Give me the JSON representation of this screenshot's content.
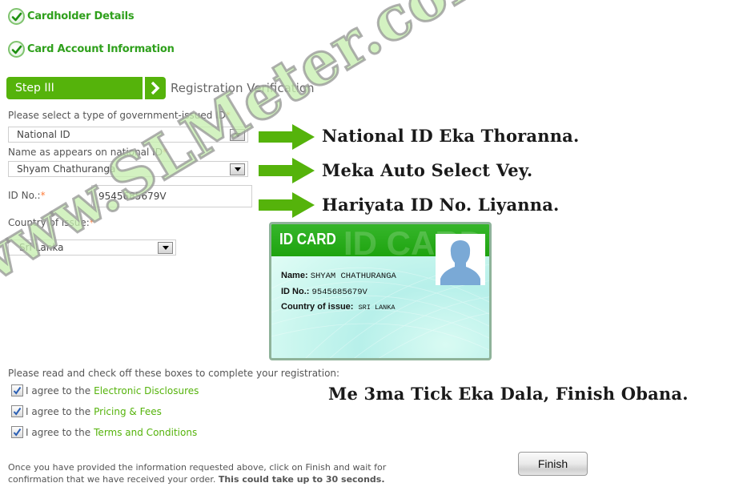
{
  "completed_steps": [
    {
      "label": "Cardholder Details",
      "icon": "check-circle-icon"
    },
    {
      "label": "Card Account Information",
      "icon": "check-circle-icon"
    }
  ],
  "current_step": {
    "step_label": "Step III",
    "title": "Registration Verification",
    "icon": "chevron-right-icon"
  },
  "form": {
    "id_type": {
      "label": "Please select a type of government-issued ID",
      "required_mark": "*",
      "value": "National ID"
    },
    "name": {
      "label": "Name as appears on national ID",
      "required_mark": "*",
      "value": "Shyam Chathuranga"
    },
    "id_no": {
      "label": "ID No.:",
      "required_mark": "*",
      "value": "9545685679V"
    },
    "country": {
      "label": "Country of issue:",
      "required_mark": "*",
      "value": "Sri Lanka"
    }
  },
  "annotations": {
    "note1": "National ID Eka Thoranna.",
    "note2": "Meka Auto Select Vey.",
    "note3": "Hariyata ID No. Liyanna.",
    "note4": "Me 3ma Tick Eka Dala, Finish Obana.",
    "arrow_color": "#55b30b"
  },
  "id_card": {
    "title": "ID CARD",
    "ghost_text": "ID CARD",
    "name_label": "Name:",
    "name_value": "SHYAM CHATHURANGA",
    "id_label": "ID No.:",
    "id_value": "9545685679V",
    "country_label": "Country of issue:",
    "country_value": "SRI LANKA",
    "photo_icon": "person-silhouette-icon"
  },
  "agreements": {
    "title": "Please read and check off these boxes to complete your registration:",
    "items": [
      {
        "prefix": "I agree to the",
        "link": "Electronic Disclosures",
        "checked": true
      },
      {
        "prefix": "I agree to the",
        "link": "Pricing & Fees",
        "checked": true
      },
      {
        "prefix": "I agree to the",
        "link": "Terms and Conditions",
        "checked": true
      }
    ]
  },
  "footer": {
    "text": "Once you have provided the information requested above, click on Finish and wait for confirmation that we have received your order.",
    "bold": "This could take up to 30 seconds."
  },
  "finish_button": "Finish",
  "watermark": "www.SLMeter.com",
  "colors": {
    "brand_green": "#55b30b",
    "done_green": "#2fa01c",
    "required": "#ff7d3b"
  }
}
